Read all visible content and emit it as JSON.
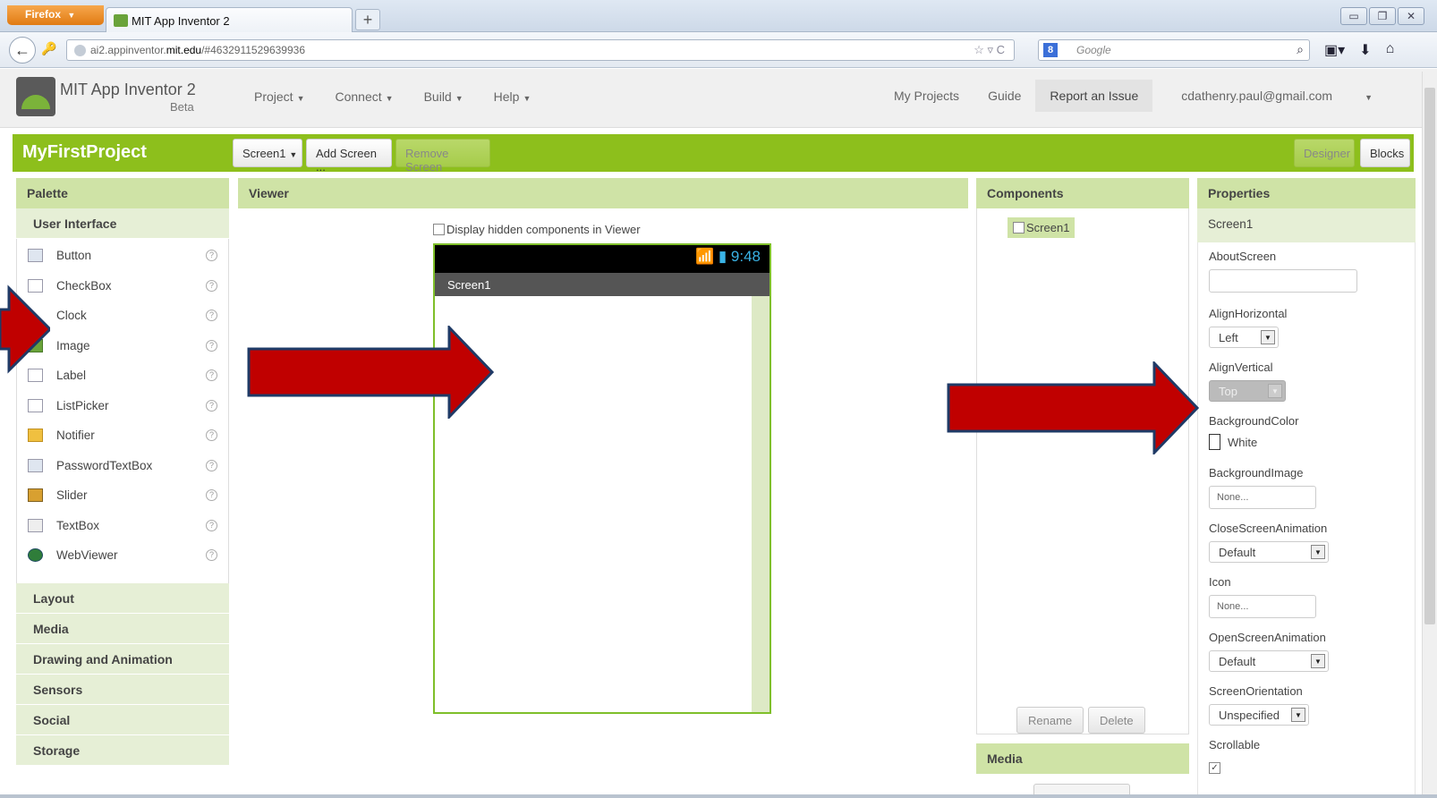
{
  "browser": {
    "app_button": "Firefox",
    "tab_title": "MIT App Inventor 2",
    "new_tab": "+",
    "url_prefix": "ai2.appinventor.",
    "url_host": "mit.edu",
    "url_path": "/#4632911529639936",
    "search_engine_icon": "8",
    "search_placeholder": "Google"
  },
  "app": {
    "title": "MIT App Inventor 2",
    "beta": "Beta",
    "menu": [
      "Project",
      "Connect",
      "Build",
      "Help"
    ],
    "my_projects": "My Projects",
    "guide": "Guide",
    "report_issue": "Report an Issue",
    "account": "cdathenry.paul@gmail.com"
  },
  "project": {
    "name": "MyFirstProject",
    "screen_select": "Screen1",
    "add_screen": "Add Screen ...",
    "remove_screen": "Remove Screen",
    "designer": "Designer",
    "blocks": "Blocks"
  },
  "palette": {
    "title": "Palette",
    "open_category": "User Interface",
    "items": [
      "Button",
      "CheckBox",
      "Clock",
      "Image",
      "Label",
      "ListPicker",
      "Notifier",
      "PasswordTextBox",
      "Slider",
      "TextBox",
      "WebViewer"
    ],
    "help_glyph": "?",
    "categories": [
      "Layout",
      "Media",
      "Drawing and Animation",
      "Sensors",
      "Social",
      "Storage"
    ]
  },
  "viewer": {
    "title": "Viewer",
    "hidden_components": "Display hidden components in Viewer",
    "phone_time": "9:48",
    "phone_screen_title": "Screen1"
  },
  "components": {
    "title": "Components",
    "screen": "Screen1",
    "rename": "Rename",
    "delete": "Delete"
  },
  "media": {
    "title": "Media"
  },
  "properties": {
    "title": "Properties",
    "subject": "Screen1",
    "about_screen": "AboutScreen",
    "align_horizontal": "AlignHorizontal",
    "align_horizontal_value": "Left",
    "align_vertical": "AlignVertical",
    "align_vertical_value": "Top",
    "background_color": "BackgroundColor",
    "background_color_value": "White",
    "background_image": "BackgroundImage",
    "background_image_value": "None...",
    "close_screen_animation": "CloseScreenAnimation",
    "close_screen_animation_value": "Default",
    "icon": "Icon",
    "icon_value": "None...",
    "open_screen_animation": "OpenScreenAnimation",
    "open_screen_animation_value": "Default",
    "screen_orientation": "ScreenOrientation",
    "screen_orientation_value": "Unspecified",
    "scrollable": "Scrollable"
  },
  "colors": {
    "accent_green": "#8dbf1c",
    "arrow_red": "#c00000",
    "arrow_border": "#1f3a66"
  }
}
